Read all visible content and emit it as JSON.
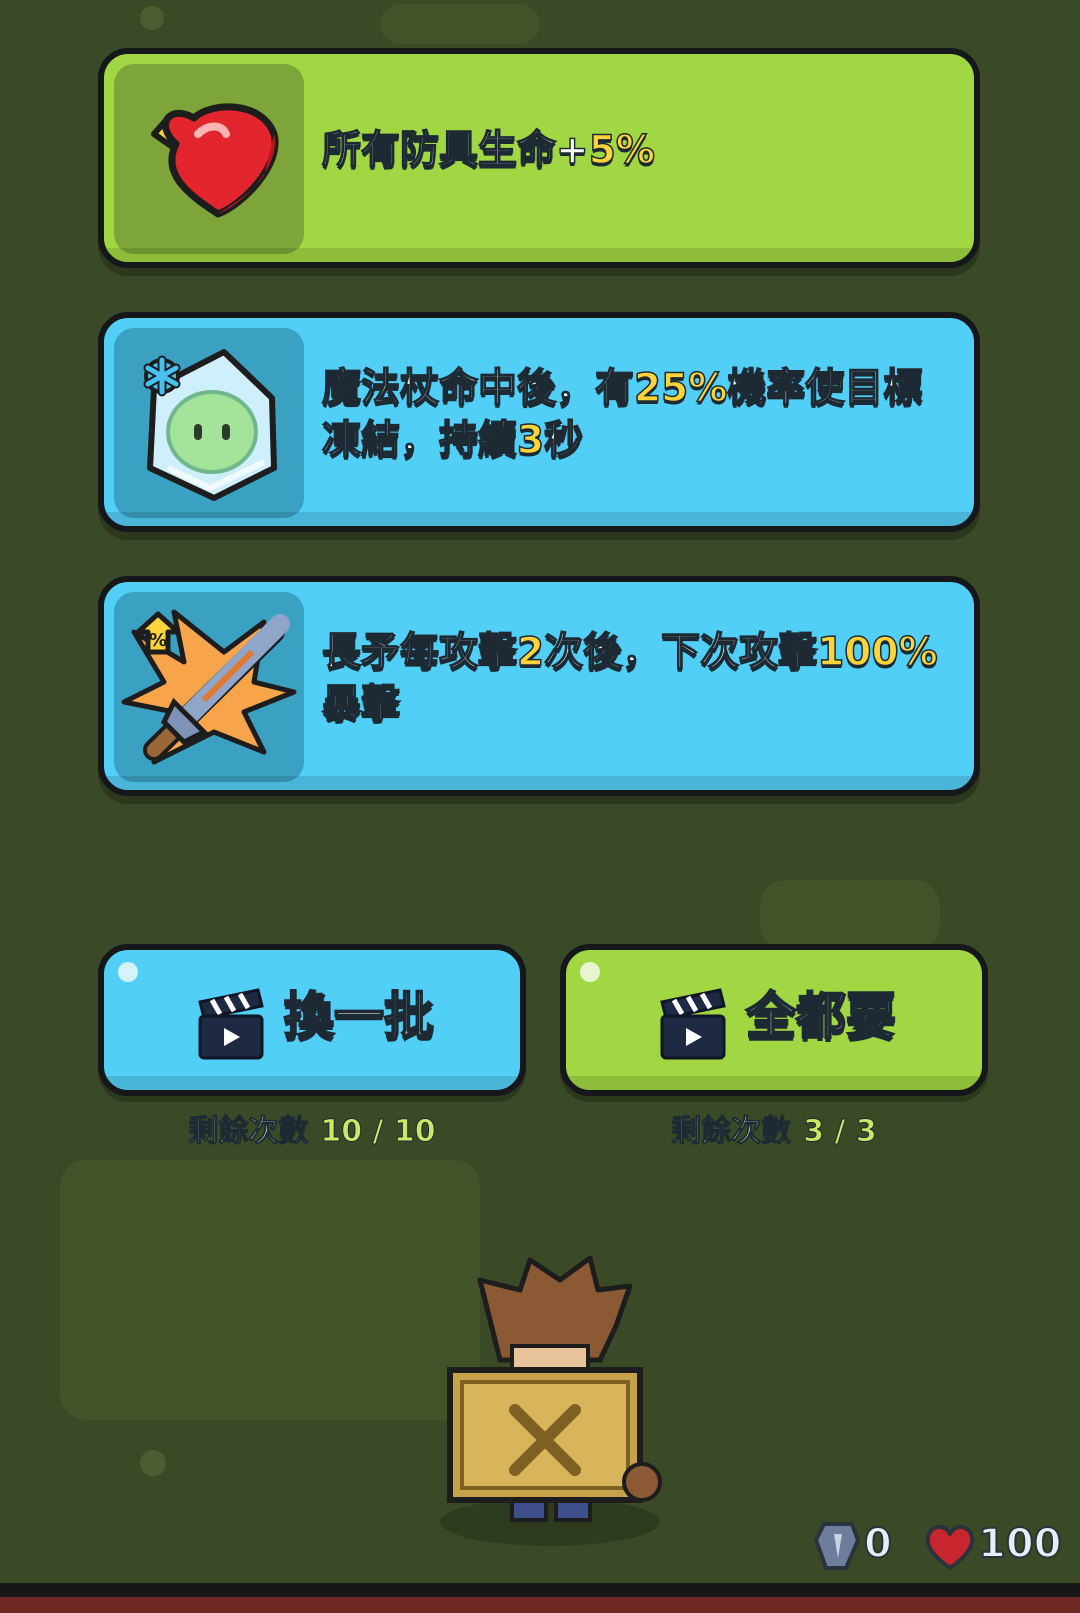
{
  "cards": [
    {
      "theme": "green",
      "icon": "heart-potion-icon",
      "text": [
        {
          "t": "所有防具生命+"
        },
        {
          "t": "5%",
          "hl": true
        }
      ]
    },
    {
      "theme": "blue",
      "icon": "frozen-slime-icon",
      "text": [
        {
          "t": "魔法杖命中後，有"
        },
        {
          "t": "25%",
          "hl": true
        },
        {
          "t": "機率使目標凍結，持續"
        },
        {
          "t": "3",
          "hl": true
        },
        {
          "t": "秒"
        }
      ]
    },
    {
      "theme": "blue",
      "icon": "spear-crit-icon",
      "text": [
        {
          "t": "長矛每攻擊"
        },
        {
          "t": "2",
          "hl": true
        },
        {
          "t": "次後，下次攻擊"
        },
        {
          "t": "100%",
          "hl": true
        },
        {
          "t": "暴擊"
        }
      ]
    }
  ],
  "buttons": {
    "refresh": {
      "label": "換一批",
      "remain_label": "剩餘次數",
      "remain_count": "10 / 10"
    },
    "take_all": {
      "label": "全都要",
      "remain_label": "剩餘次數",
      "remain_count": "3 / 3"
    }
  },
  "hud": {
    "gems": "0",
    "health": "100"
  },
  "colors": {
    "card_green": "#a2d744",
    "card_blue": "#52cff7",
    "highlight": "#ffd43a",
    "background": "#3b4a26"
  }
}
